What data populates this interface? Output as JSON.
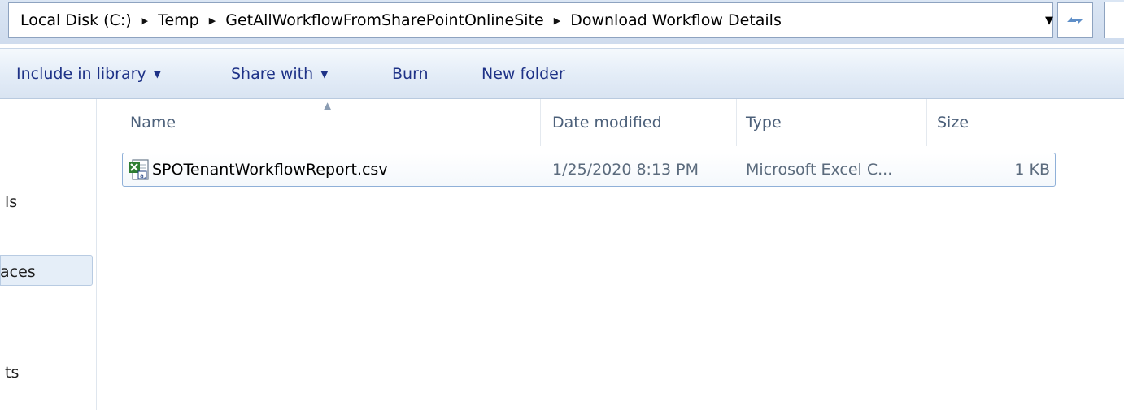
{
  "address_bar": {
    "breadcrumbs": [
      "Local Disk (C:)",
      "Temp",
      "GetAllWorkflowFromSharePointOnlineSite",
      "Download Workflow Details"
    ],
    "dropdown_icon": "chevron-down-icon",
    "refresh_icon": "refresh-icon"
  },
  "toolbar": {
    "include_in_library": "Include in library",
    "share_with": "Share with",
    "burn": "Burn",
    "new_folder": "New folder"
  },
  "nav_pane": {
    "items": [
      "ls",
      "aces",
      "ts"
    ],
    "selected_index": 1
  },
  "columns": {
    "name": "Name",
    "date_modified": "Date modified",
    "type": "Type",
    "size": "Size"
  },
  "files": [
    {
      "name": "SPOTenantWorkflowReport.csv",
      "date_modified": "1/25/2020 8:13 PM",
      "type": "Microsoft Excel C...",
      "size": "1 KB",
      "icon": "excel-csv-file-icon"
    }
  ],
  "colors": {
    "command_text": "#1e3287",
    "header_text": "#4c607a",
    "selection_border": "#8fb0d8",
    "chrome_background": "#dbe6f4"
  }
}
